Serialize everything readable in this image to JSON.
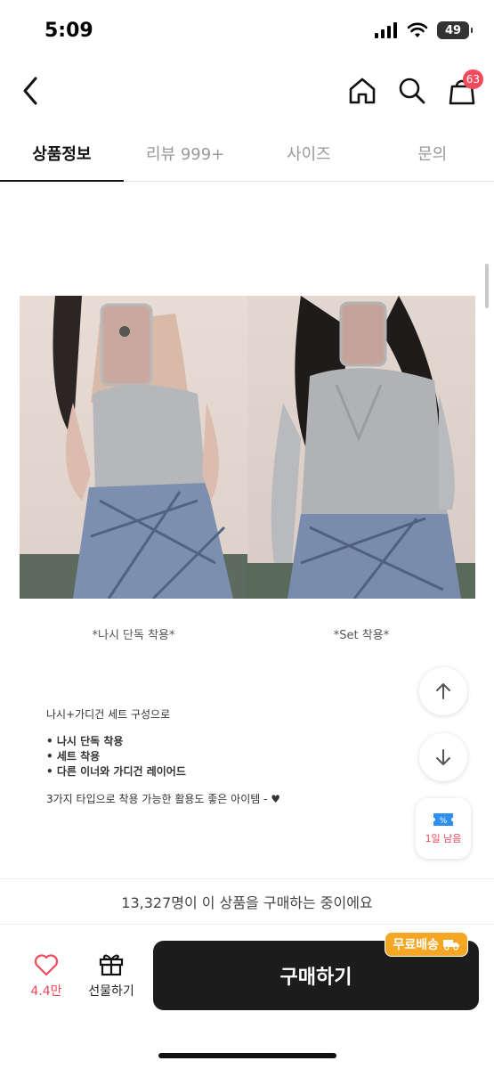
{
  "status_bar": {
    "time": "5:09",
    "battery": "49"
  },
  "nav": {
    "cart_count": "63"
  },
  "tabs": [
    {
      "label": "상품정보"
    },
    {
      "label": "리뷰 999+"
    },
    {
      "label": "사이즈"
    },
    {
      "label": "문의"
    }
  ],
  "product": {
    "captions": [
      "*나시 단독 착용*",
      "*Set 착용*"
    ],
    "description": {
      "intro": "나시+가디건 세트 구성으로",
      "bullets": [
        "• 나시 단독 착용",
        "• 세트 착용",
        "• 다른 이너와 가디건 레이어드"
      ],
      "closing": "3가지 타입으로 착용 가능한 활용도 좋은 아이템 - ♥"
    }
  },
  "coupon": {
    "label": "1일 남음"
  },
  "buyers_text": "13,327명이 이 상품을 구매하는 중이에요",
  "bottom": {
    "like_count": "4.4만",
    "gift_label": "선물하기",
    "buy_label": "구매하기",
    "free_shipping": "무료배송"
  },
  "colors": {
    "accent": "#f24a5c",
    "buy_button": "#1c1c1c",
    "free_ship": "#f5a623"
  }
}
